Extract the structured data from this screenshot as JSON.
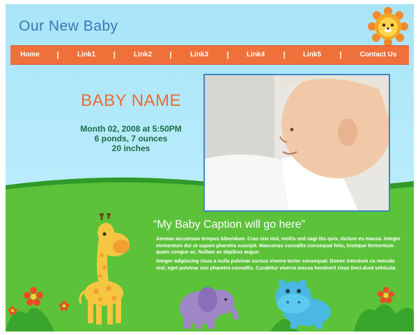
{
  "header": {
    "title": "Our New Baby"
  },
  "nav": {
    "items": [
      "Home",
      "Link1",
      "Link2",
      "Link3",
      "Link4",
      "Link5",
      "Contact Us"
    ],
    "separator": "|"
  },
  "hero": {
    "name": "BABY NAME",
    "date": "Month 02, 2008 at 5:50PM",
    "weight": "6 ponds, 7 ounces",
    "length": "20 inches"
  },
  "caption": {
    "title": "“My Baby Caption will go here”",
    "paragraph1": "Aenean accumsan tempus bibendum. Cras nisi nisl, mollis sed sagi ttis quis, dictum eu massa. Integer elementum dui ut sapien pharetra suscipit. Maecenas convallis consequat felis, tristique fermentum quam congue ac. Nullam ac dapibus augue.",
    "paragraph2": "Integer adipiscing risus  a nulla pulvinar cursus viverra tortor consequat. Donec interdum co mmodo nisl, eget pulvinar nisi pharetra convallis. Curabitur viverra massa hendrerit risus tinci-dunt vehicula."
  },
  "colors": {
    "sky": "#a8e4f8",
    "nav": "#f0703a",
    "title": "#3a78b5",
    "baby_name": "#ef6a33",
    "info": "#1d6a47",
    "grass": "#5cc23a",
    "photo_border": "#3b87c6"
  },
  "icons": [
    "sun-lion-icon",
    "giraffe-icon",
    "elephant-icon",
    "hippo-icon",
    "flower-icon"
  ]
}
